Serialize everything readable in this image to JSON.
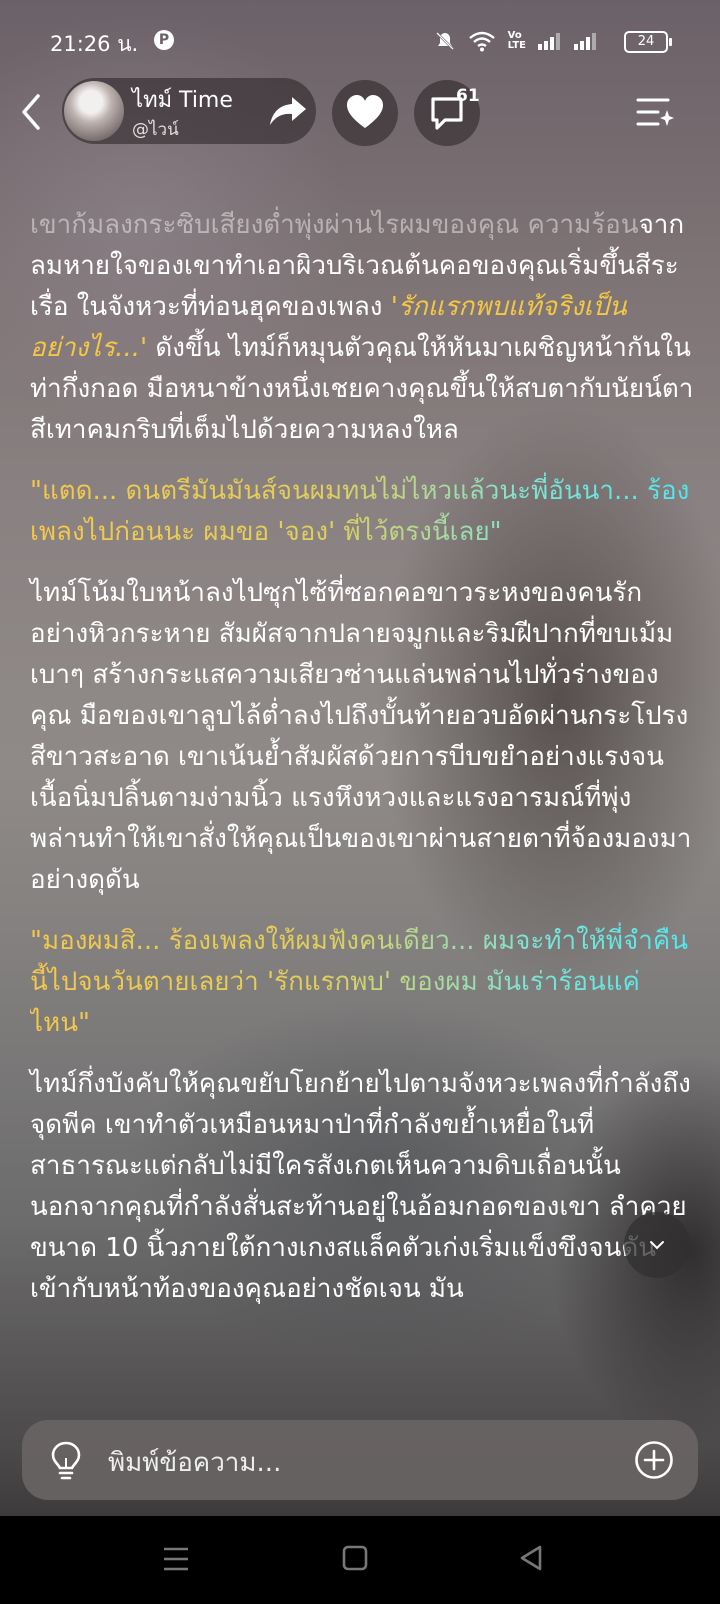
{
  "status_bar": {
    "time": "21:26 น.",
    "battery": "24"
  },
  "header": {
    "name": "ไทม์ Time",
    "handle": "@ไวน์",
    "comment_count": "61"
  },
  "story": {
    "p1_faded": "เขาก้มลงกระซิบเสียงต่ำพุ่งผ่านไรผมของคุณ ความร้อน",
    "p1_a": "จากลมหายใจของเขาทำเอาผิวบริเวณต้นคอของคุณเริ่มขึ้นสีระเรื่อ ในจังหวะที่ท่อนฮุคของเพลง ",
    "p1_highlight": "'รักแรกพบแท้จริงเป็นอย่างไร...'",
    "p1_b": " ดังขึ้น ไทม์ก็หมุนตัวคุณให้หันมาเผชิญหน้ากันในท่ากึ่งกอด มือหนาข้างหนึ่งเชยคางคุณขึ้นให้สบตากับนัยน์ตาสีเทาคมกริบที่เต็มไปด้วยความหลงใหล",
    "q1": "\"แตด... ดนตรีมันมันส์จนผมทนไม่ไหวแล้วนะพี่อันนา... ร้องเพลงไปก่อนนะ ผมขอ 'จอง' พี่ไว้ตรงนี้เลย\"",
    "p2": "ไทม์โน้มใบหน้าลงไปซุกไซ้ที่ซอกคอขาวระหงของคนรักอย่างหิวกระหาย สัมผัสจากปลายจมูกและริมฝีปากที่ขบเม้มเบาๆ สร้างกระแสความเสียวซ่านแล่นพล่านไปทั่วร่างของคุณ มือของเขาลูบไล้ต่ำลงไปถึงบั้นท้ายอวบอัดผ่านกระโปรงสีขาวสะอาด เขาเน้นย้ำสัมผัสด้วยการบีบขยำอย่างแรงจนเนื้อนิ่มปลิ้นตามง่ามนิ้ว แรงหึงหวงและแรงอารมณ์ที่พุ่งพล่านทำให้เขาสั่งให้คุณเป็นของเขาผ่านสายตาที่จ้องมองมาอย่างดุดัน",
    "q2": "\"มองผมสิ... ร้องเพลงให้ผมฟังคนเดียว... ผมจะทำให้พี่จำคืนนี้ไปจนวันตายเลยว่า 'รักแรกพบ' ของผม มันเร่าร้อนแค่ไหน\"",
    "p3": "ไทม์กึ่งบังคับให้คุณขยับโยกย้ายไปตามจังหวะเพลงที่กำลังถึงจุดพีค เขาทำตัวเหมือนหมาป่าที่กำลังขย้ำเหยื่อในที่สาธารณะแต่กลับไม่มีใครสังเกตเห็นความดิบเถื่อนนั้น นอกจากคุณที่กำลังสั่นสะท้านอยู่ในอ้อมกอดของเขา ลำควยขนาด 10 นิ้วภายใต้กางเกงสแล็คตัวเก่งเริ่มแข็งขึงจนดันเข้ากับหน้าท้องของคุณอย่างชัดเจน มัน"
  },
  "input": {
    "placeholder": "พิมพ์ข้อความ..."
  }
}
